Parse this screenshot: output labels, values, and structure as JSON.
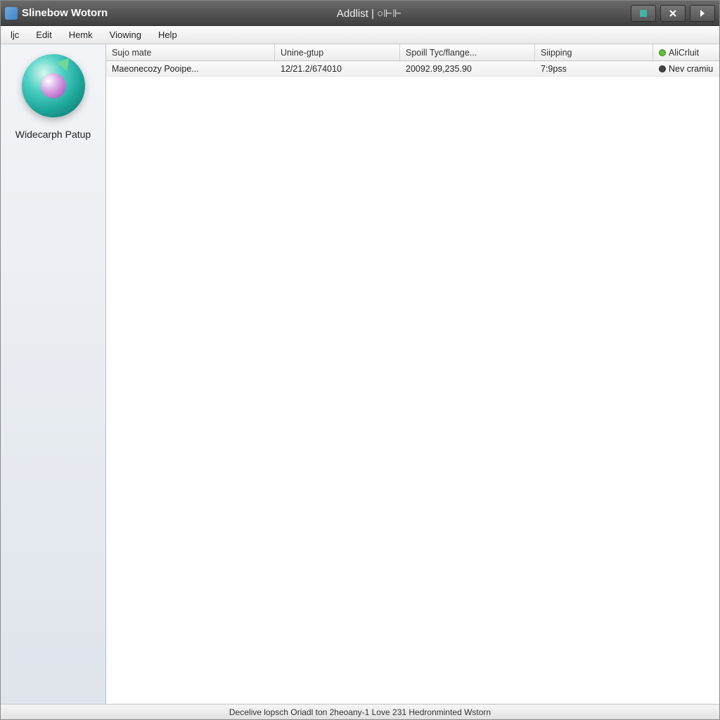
{
  "titlebar": {
    "app_name": "Slinebow Wotorn",
    "center_text": "Addlist | ○⊩⊩"
  },
  "menu": {
    "items": [
      "ljc",
      "Edit",
      "Hemk",
      "Viowing",
      "Help"
    ]
  },
  "sidebar": {
    "label": "Widecarph Patup"
  },
  "columns": [
    "Sujo mate",
    "Unine-gtup",
    "Spoill Tyc/flange...",
    "Siipping",
    "AliCrluit"
  ],
  "rows": [
    {
      "c1": "Maeonecozy Pooipe...",
      "c2": "12/21.2/674010",
      "c3": "20092.99,235.90",
      "c4": "7:9pss",
      "c5": "Nev cramiu"
    }
  ],
  "statusbar": {
    "text": "Decelive lopsch Oriadl ton 2heoany-1 Love 231 Hedronminted Wstorn"
  }
}
